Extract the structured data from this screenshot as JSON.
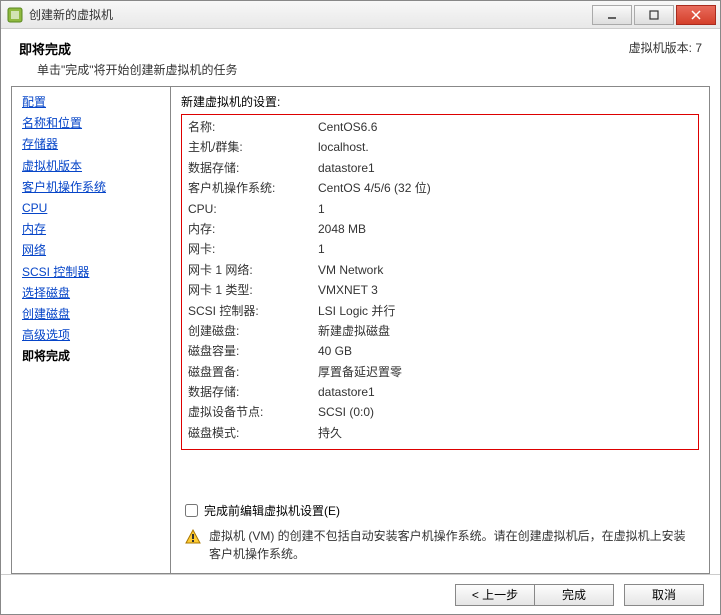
{
  "window": {
    "title": "创建新的虚拟机"
  },
  "header": {
    "title": "即将完成",
    "subtitle": "单击\"完成\"将开始创建新虚拟机的任务",
    "version_label": "虚拟机版本: 7"
  },
  "sidebar": {
    "items": [
      {
        "label": "配置",
        "link": true
      },
      {
        "label": "名称和位置",
        "link": true
      },
      {
        "label": "存储器",
        "link": true
      },
      {
        "label": "虚拟机版本",
        "link": true
      },
      {
        "label": "客户机操作系统",
        "link": true
      },
      {
        "label": "CPU",
        "link": true
      },
      {
        "label": "内存",
        "link": true
      },
      {
        "label": "网络",
        "link": true
      },
      {
        "label": "SCSI 控制器",
        "link": true
      },
      {
        "label": "选择磁盘",
        "link": true
      },
      {
        "label": "创建磁盘",
        "link": true
      },
      {
        "label": "高级选项",
        "link": true
      },
      {
        "label": "即将完成",
        "link": false
      }
    ]
  },
  "content": {
    "section_title": "新建虚拟机的设置:",
    "rows": [
      {
        "label": "名称:",
        "value": "CentOS6.6"
      },
      {
        "label": "主机/群集:",
        "value": "localhost."
      },
      {
        "label": "数据存储:",
        "value": "datastore1"
      },
      {
        "label": "客户机操作系统:",
        "value": "CentOS 4/5/6 (32 位)"
      },
      {
        "label": "CPU:",
        "value": "1"
      },
      {
        "label": "内存:",
        "value": "2048 MB"
      },
      {
        "label": "网卡:",
        "value": "1"
      },
      {
        "label": "网卡 1 网络:",
        "value": "VM Network"
      },
      {
        "label": "网卡 1 类型:",
        "value": "VMXNET 3"
      },
      {
        "label": "SCSI 控制器:",
        "value": "LSI Logic 并行"
      },
      {
        "label": "创建磁盘:",
        "value": "新建虚拟磁盘"
      },
      {
        "label": "磁盘容量:",
        "value": "40 GB"
      },
      {
        "label": "磁盘置备:",
        "value": "厚置备延迟置零"
      },
      {
        "label": "数据存储:",
        "value": "datastore1"
      },
      {
        "label": "虚拟设备节点:",
        "value": "SCSI (0:0)"
      },
      {
        "label": "磁盘模式:",
        "value": "持久"
      }
    ],
    "checkbox_label": "完成前编辑虚拟机设置(E)",
    "note": "虚拟机 (VM) 的创建不包括自动安装客户机操作系统。请在创建虚拟机后，在虚拟机上安装客户机操作系统。"
  },
  "footer": {
    "back": "< 上一步",
    "finish": "完成",
    "cancel": "取消"
  }
}
